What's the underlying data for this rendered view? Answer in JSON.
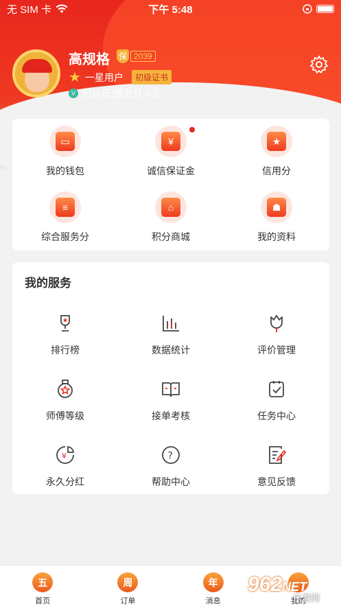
{
  "status": {
    "carrier": "无 SIM 卡",
    "time": "下午 5:48"
  },
  "profile": {
    "name": "高规格",
    "bao_mark": "保",
    "bao_number": "2039",
    "level": "一星用户",
    "cert": "初级证书",
    "verify_mark": "V",
    "verified": "已认证",
    "service_score": "|服务分 8.2"
  },
  "top_menu": [
    {
      "label": "我的钱包",
      "icon": "wallet-icon"
    },
    {
      "label": "诚信保证金",
      "icon": "deposit-shield-icon",
      "glyph": "¥"
    },
    {
      "label": "信用分",
      "icon": "credit-bookmark-icon",
      "glyph": "★"
    },
    {
      "label": "综合服务分",
      "icon": "service-score-icon"
    },
    {
      "label": "积分商城",
      "icon": "points-mall-icon"
    },
    {
      "label": "我的资料",
      "icon": "profile-card-icon"
    }
  ],
  "services": {
    "title": "我的服务",
    "items": [
      {
        "label": "排行榜",
        "icon": "trophy-icon"
      },
      {
        "label": "数据统计",
        "icon": "bar-chart-icon"
      },
      {
        "label": "评价管理",
        "icon": "flower-icon"
      },
      {
        "label": "师傅等级",
        "icon": "medal-icon"
      },
      {
        "label": "接单考核",
        "icon": "open-book-icon"
      },
      {
        "label": "任务中心",
        "icon": "task-check-icon"
      },
      {
        "label": "永久分红",
        "icon": "dividend-icon",
        "glyph": "¥"
      },
      {
        "label": "帮助中心",
        "icon": "help-icon",
        "glyph": "?"
      },
      {
        "label": "意见反馈",
        "icon": "feedback-edit-icon"
      }
    ]
  },
  "tabbar": [
    {
      "label": "首页",
      "glyph": "五"
    },
    {
      "label": "订单",
      "glyph": "周"
    },
    {
      "label": "消息",
      "glyph": "年"
    },
    {
      "label": "我的",
      "glyph": ""
    }
  ],
  "watermark": {
    "brand": "962",
    "net": "NET",
    "text": "乐游网"
  },
  "colors": {
    "primary": "#e8261d",
    "accent": "#f5b43c",
    "background": "#f2f2f2"
  }
}
